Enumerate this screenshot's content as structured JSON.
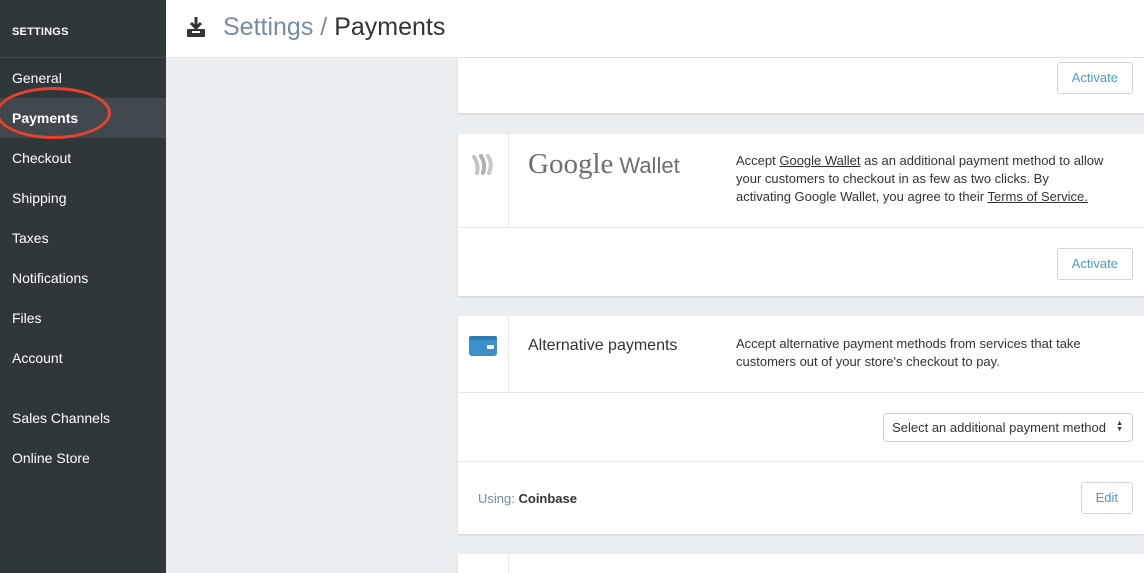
{
  "sidebar": {
    "heading": "SETTINGS",
    "items": [
      {
        "label": "General"
      },
      {
        "label": "Payments"
      },
      {
        "label": "Checkout"
      },
      {
        "label": "Shipping"
      },
      {
        "label": "Taxes"
      },
      {
        "label": "Notifications"
      },
      {
        "label": "Files"
      },
      {
        "label": "Account"
      },
      {
        "label": "Sales Channels"
      },
      {
        "label": "Online Store"
      }
    ],
    "active_item": "Payments"
  },
  "header": {
    "breadcrumb_parent": "Settings",
    "separator": " / ",
    "title": "Payments",
    "icon": "download-tray-icon"
  },
  "cards": {
    "top_partial": {
      "activate_label": "Activate"
    },
    "google_wallet": {
      "logo_google": "Google",
      "logo_wallet": "Wallet",
      "desc_prefix": "Accept ",
      "desc_link": "Google Wallet",
      "desc_middle": " as an additional payment method to allow your customers to checkout in as few as two clicks. By activating Google Wallet, you agree to their ",
      "desc_terms": "Terms of Service.",
      "activate_label": "Activate",
      "icon": "wallet-waves-icon"
    },
    "alternative": {
      "title": "Alternative payments",
      "description": "Accept alternative payment methods from services that take customers out of your store's checkout to pay.",
      "select_value": "Select an additional payment method",
      "using_label": "Using:",
      "using_value": "Coinbase",
      "edit_label": "Edit",
      "icon": "credit-card-icon"
    }
  },
  "colors": {
    "sidebar_bg": "#30373b",
    "accent": "#479ccf",
    "highlight": "#e8412c"
  }
}
